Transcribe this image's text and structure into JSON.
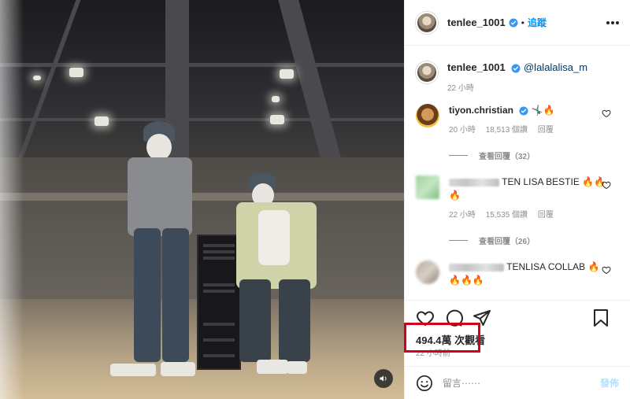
{
  "post": {
    "username": "tenlee_1001",
    "follow_label": "追蹤",
    "caption_mention": "@lalalalisa_m",
    "caption_time": "22 小時"
  },
  "comments": [
    {
      "username": "tiyon.christian",
      "text": "🤸🏿‍♂️🔥",
      "time": "20 小時",
      "likes": "18,513 個讚",
      "reply_label": "回覆",
      "view_replies": "查看回覆（32）"
    },
    {
      "username": "",
      "text": "TEN LISA BESTIE 🔥🔥🔥",
      "time": "22 小時",
      "likes": "15,535 個讚",
      "reply_label": "回覆",
      "view_replies": "查看回覆（26）"
    },
    {
      "username": "",
      "text": "TENLISA COLLAB 🔥🔥🔥🔥"
    }
  ],
  "stats": {
    "views": "494.4萬 次觀看",
    "time_ago": "22 小時前"
  },
  "composer": {
    "placeholder": "留言⋯⋯",
    "post_label": "發佈"
  },
  "icons": {
    "verified": "verified-badge-icon",
    "like": "heart-icon",
    "comment": "comment-bubble-icon",
    "share": "paper-plane-icon",
    "save": "bookmark-icon",
    "emoji": "smiley-icon",
    "sound": "speaker-icon",
    "more": "more-options-icon"
  },
  "colors": {
    "accent_blue": "#0095f6",
    "verified_blue": "#3897f0",
    "highlight_red": "#d0021b"
  }
}
